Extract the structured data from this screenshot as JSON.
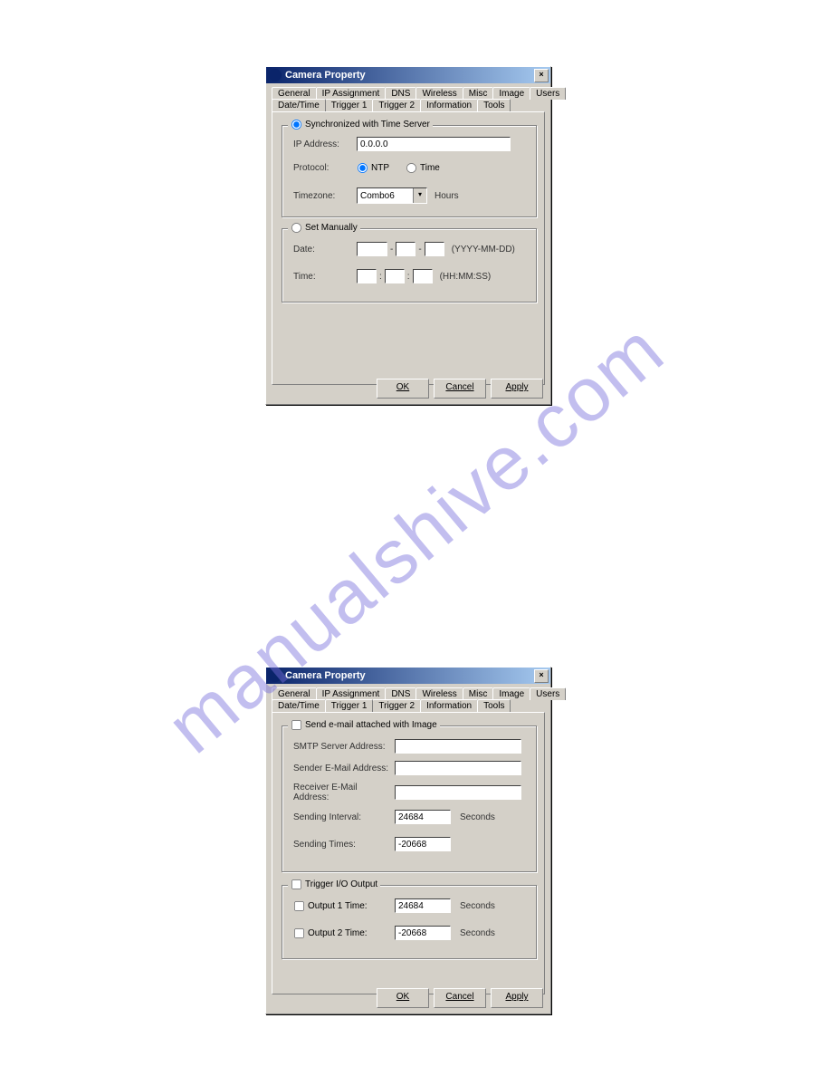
{
  "watermark": "manualshive.com",
  "dialog1": {
    "title": "Camera Property",
    "tabs_row1": [
      "General",
      "IP Assignment",
      "DNS",
      "Wireless",
      "Misc",
      "Image",
      "Users"
    ],
    "tabs_row2": [
      "Date/Time",
      "Trigger 1",
      "Trigger 2",
      "Information",
      "Tools"
    ],
    "active_tab": "Date/Time",
    "group_sync": {
      "legend": "Synchronized with Time Server",
      "ip_label": "IP Address:",
      "ip_value": "0.0.0.0",
      "protocol_label": "Protocol:",
      "protocol_ntp": "NTP",
      "protocol_time": "Time",
      "tz_label": "Timezone:",
      "tz_value": "Combo6",
      "tz_unit": "Hours"
    },
    "group_manual": {
      "legend": "Set Manually",
      "date_label": "Date:",
      "date_sep": "-",
      "date_hint": "(YYYY-MM-DD)",
      "time_label": "Time:",
      "time_sep": ":",
      "time_hint": "(HH:MM:SS)"
    },
    "buttons": {
      "ok": "OK",
      "cancel": "Cancel",
      "apply": "Apply"
    }
  },
  "dialog2": {
    "title": "Camera Property",
    "tabs_row1": [
      "General",
      "IP Assignment",
      "DNS",
      "Wireless",
      "Misc",
      "Image",
      "Users"
    ],
    "tabs_row2": [
      "Date/Time",
      "Trigger 1",
      "Trigger 2",
      "Information",
      "Tools"
    ],
    "active_tab": "Trigger 1",
    "group_email": {
      "legend": "Send e-mail attached with Image",
      "smtp_label": "SMTP Server Address:",
      "sender_label": "Sender E-Mail Address:",
      "receiver_label": "Receiver E-Mail Address:",
      "interval_label": "Sending Interval:",
      "interval_value": "24684",
      "interval_unit": "Seconds",
      "times_label": "Sending Times:",
      "times_value": "-20668"
    },
    "group_io": {
      "legend": "Trigger I/O Output",
      "out1_label": "Output 1 Time:",
      "out1_value": "24684",
      "out1_unit": "Seconds",
      "out2_label": "Output 2 Time:",
      "out2_value": "-20668",
      "out2_unit": "Seconds"
    },
    "buttons": {
      "ok": "OK",
      "cancel": "Cancel",
      "apply": "Apply"
    }
  }
}
